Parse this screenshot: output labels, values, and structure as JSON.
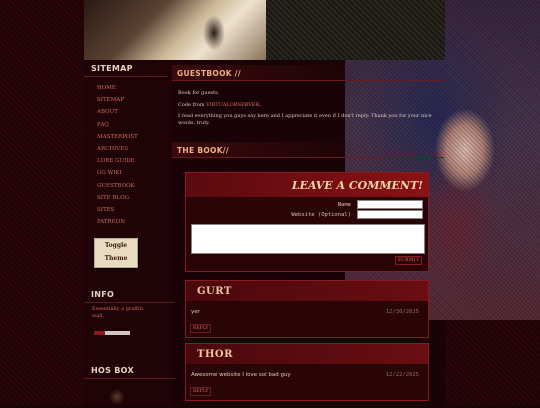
{
  "sidebar": {
    "sitemap_title": "SITEMAP",
    "nav": [
      "HOME",
      "SITEMAP",
      "ABOUT",
      "FAQ",
      "MASTERPOST",
      "ARCHIVES",
      "LORE GUIDE",
      "GG WIKI",
      "GUESTBOOK",
      "SITE BLOG",
      "SITES",
      "PATREON"
    ],
    "toggle_line1": "Toggle",
    "toggle_line2": "Theme",
    "info_title": "INFO",
    "info_text": "Essentially a graffiti wall.",
    "hos_title": "HOS BOX"
  },
  "main": {
    "guestbook_title": "GUESTBOOK //",
    "intro_1": "Book for guests.",
    "intro_2_prefix": "Code from ",
    "intro_2_link": "VIRTUALOBSERVER",
    "intro_2_suffix": ".",
    "intro_3": "I read everything you guys say here and I appreciate it even if I don't reply. Thank you for your nice words, truly.",
    "book_title": "THE BOOK//",
    "form": {
      "title": "LEAVE A COMMENT!",
      "name_label": "Name",
      "website_label": "Website (Optional)",
      "submit_label": "SUBMIT"
    },
    "entries": [
      {
        "name": "GURT",
        "message": "yer",
        "date": "12/30/2025",
        "reply_label": "REPLY"
      },
      {
        "name": "THOR",
        "message": "Awesome website I love sol bad guy",
        "date": "12/22/2025",
        "reply_label": "REPLY"
      }
    ]
  },
  "colors": {
    "accent": "#d36a5a",
    "heading": "#f0b080",
    "panel": "#2a0508",
    "border": "#8a1a20"
  }
}
